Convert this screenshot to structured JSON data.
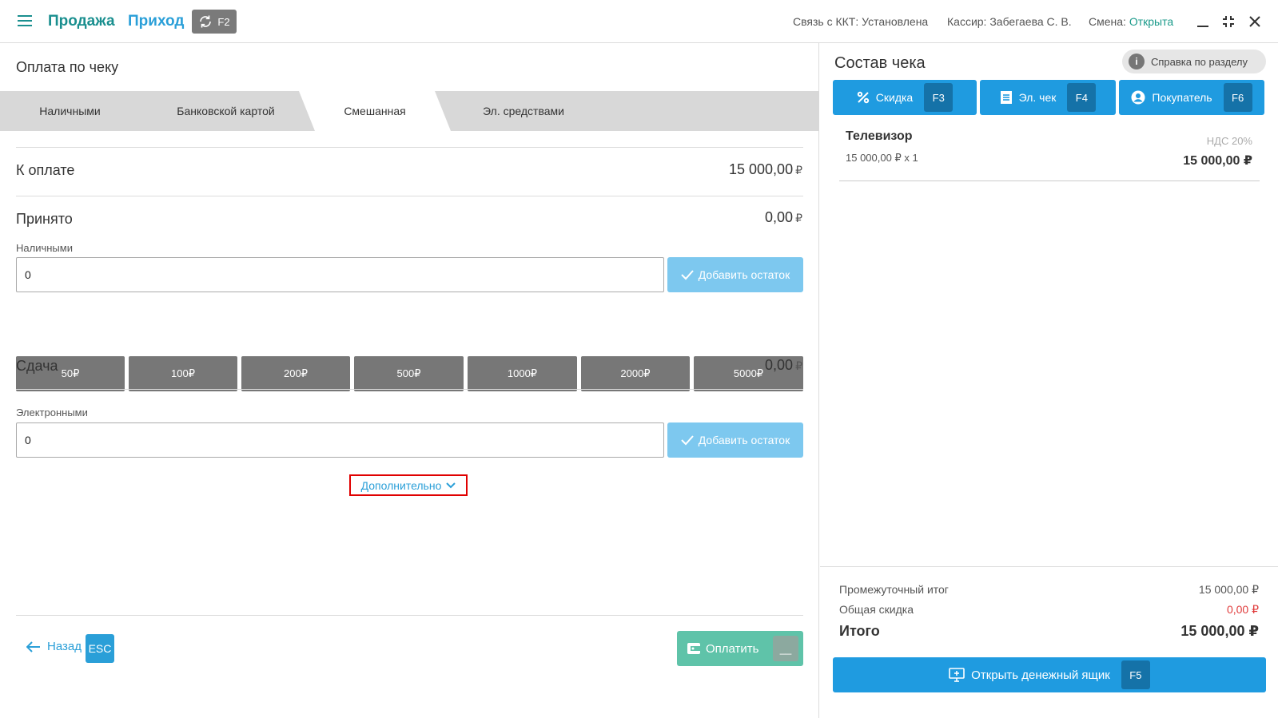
{
  "header": {
    "sale": "Продажа",
    "income": "Приход",
    "switch_key": "F2",
    "kkt_status": "Связь с ККТ: Установлена",
    "cashier": "Кассир: Забегаева С. В.",
    "shift_label": "Смена:",
    "shift_value": "Открыта"
  },
  "left": {
    "title": "Оплата по чеку",
    "tabs": [
      "Наличными",
      "Банковской картой",
      "Смешанная",
      "Эл. средствами"
    ],
    "active_tab": "Смешанная",
    "to_pay_label": "К оплате",
    "to_pay_value": "15 000,00",
    "accepted_label": "Принято",
    "accepted_value": "0,00",
    "cash_label": "Наличными",
    "cash_value": "0",
    "add_rest": "Добавить остаток",
    "bills": [
      "50₽",
      "100₽",
      "200₽",
      "500₽",
      "1000₽",
      "2000₽",
      "5000₽"
    ],
    "change_label": "Сдача",
    "change_value": "0,00",
    "electronic_label": "Электронными",
    "electronic_value": "0",
    "more": "Дополнительно",
    "back": "Назад",
    "esc": "ESC",
    "pay": "Оплатить",
    "pay_key": "__",
    "currency": "₽"
  },
  "right": {
    "title": "Состав чека",
    "help": "Справка по разделу",
    "discount": "Скидка",
    "discount_key": "F3",
    "echeck": "Эл. чек",
    "echeck_key": "F4",
    "buyer": "Покупатель",
    "buyer_key": "F6",
    "item": {
      "name": "Телевизор",
      "price": "15 000,00 ₽ x 1",
      "vat": "НДС 20%",
      "sum": "15 000,00 ₽"
    },
    "subtotal_label": "Промежуточный итог",
    "subtotal_value": "15 000,00 ₽",
    "discount_total_label": "Общая скидка",
    "discount_total_value": "0,00 ₽",
    "total_label": "Итого",
    "total_value": "15 000,00 ₽",
    "cashbox": "Открыть денежный ящик",
    "cashbox_key": "F5"
  }
}
